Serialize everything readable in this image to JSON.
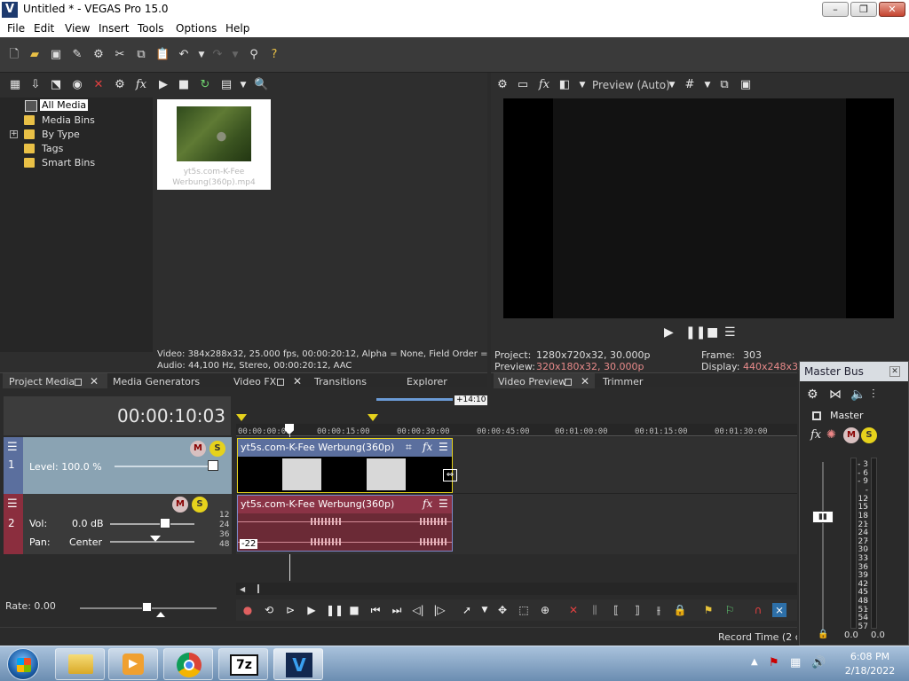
{
  "window": {
    "title": "Untitled * - VEGAS Pro 15.0",
    "app_icon_letter": "V"
  },
  "menu": [
    "File",
    "Edit",
    "View",
    "Insert",
    "Tools",
    "Options",
    "Help"
  ],
  "project_media": {
    "tree": [
      "All Media",
      "Media Bins",
      "By Type",
      "Tags",
      "Smart Bins"
    ],
    "expander": "+",
    "thumbnail_label": "yt5s.com-K-Fee Werbung(360p).mp4",
    "info_video": "Video: 384x288x32, 25.000 fps, 00:00:20:12, Alpha = None, Field Order = N",
    "info_audio": "Audio: 44,100 Hz, Stereo, 00:00:20:12, AAC"
  },
  "left_tabs": [
    "Project Media",
    "Media Generators",
    "Video FX",
    "Transitions",
    "Explorer"
  ],
  "preview": {
    "mode_label": "Preview (Auto)",
    "project_label": "Project:",
    "project_value": "1280x720x32, 30.000p",
    "preview_label": "Preview:",
    "preview_value": "320x180x32, 30.000p",
    "frame_label": "Frame:",
    "frame_value": "303",
    "display_label": "Display:",
    "display_value": "440x248x32",
    "tabs": [
      "Video Preview",
      "Trimmer"
    ]
  },
  "timeline": {
    "timecode": "00:00:10:03",
    "loop_offset": "+14:10",
    "ruler": [
      "00:00:00:00",
      "00:00:15:00",
      "00:00:30:00",
      "00:00:45:00",
      "00:01:00:00",
      "00:01:15:00",
      "00:01:30:00"
    ],
    "track1": {
      "number": "1",
      "level_label": "Level: 100.0 %",
      "level": 1.0,
      "clip_title": "yt5s.com-K-Fee Werbung(360p)"
    },
    "track2": {
      "number": "2",
      "vol_label": "Vol:",
      "vol_value": "0.0 dB",
      "pan_label": "Pan:",
      "pan_value": "Center",
      "clip_title": "yt5s.com-K-Fee Werbung(360p)",
      "scale": [
        "12",
        "24",
        "36",
        "48"
      ],
      "neg_badge": "-22"
    },
    "rate_label": "Rate: 0.00",
    "record_time": "Record Time (2 cha"
  },
  "master_bus": {
    "title": "Master Bus",
    "master_label": "Master",
    "scale": [
      "3",
      "6",
      "9",
      "12",
      "15",
      "18",
      "21",
      "24",
      "27",
      "30",
      "33",
      "36",
      "39",
      "42",
      "45",
      "48",
      "51",
      "54",
      "57"
    ],
    "readout_left": "0.0",
    "readout_right": "0.0"
  },
  "taskbar": {
    "time": "6:08 PM",
    "date": "2/18/2022",
    "apps": [
      "explorer",
      "media-player",
      "chrome",
      "7zip",
      "vegas"
    ],
    "sevenzip_label": "7z",
    "vegas_label": "V"
  },
  "colors": {
    "video_track": "#5b6f9e",
    "audio_track": "#8b2e3e",
    "video_header": "#8aa3b3",
    "audio_header": "#3a3a3a",
    "accent_yellow": "#e6d21c"
  }
}
